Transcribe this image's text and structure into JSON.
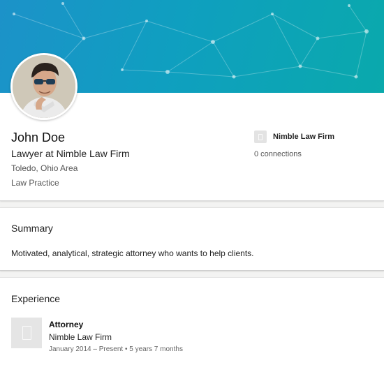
{
  "profile": {
    "name": "John Doe",
    "headline": "Lawyer at Nimble Law Firm",
    "location": "Toledo, Ohio Area",
    "industry": "Law Practice",
    "current_company": "Nimble Law Firm",
    "connections": "0 connections",
    "icons": {
      "banner": "network-pattern",
      "avatar": "profile-photo",
      "company": "building-icon"
    }
  },
  "summary": {
    "title": "Summary",
    "text": "Motivated, analytical, strategic attorney who wants to help clients."
  },
  "experience": {
    "title": "Experience",
    "items": [
      {
        "title": "Attorney",
        "company": "Nimble Law Firm",
        "dates": "January 2014 – Present • 5 years 7 months"
      }
    ]
  },
  "colors": {
    "banner_start": "#1c92c9",
    "banner_end": "#0aa9ac",
    "background": "#f3f3f2"
  }
}
